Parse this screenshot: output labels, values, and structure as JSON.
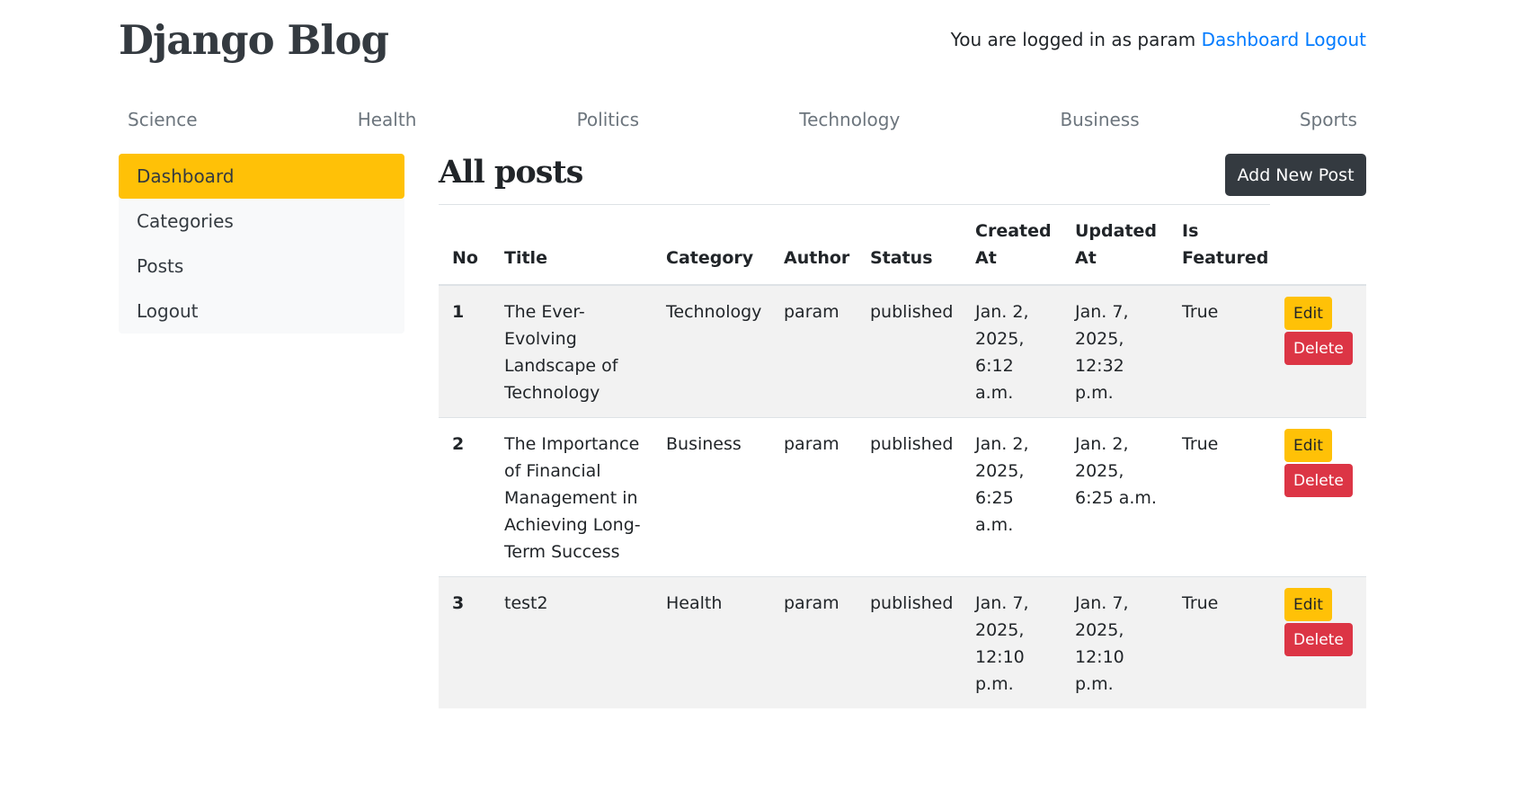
{
  "header": {
    "brand": "Django Blog",
    "logged_in_prefix": "You are logged in as param",
    "dashboard_link": "Dashboard",
    "logout_link": "Logout"
  },
  "categories_nav": [
    "Science",
    "Health",
    "Politics",
    "Technology",
    "Business",
    "Sports"
  ],
  "sidebar": {
    "items": [
      {
        "label": "Dashboard",
        "active": true
      },
      {
        "label": "Categories",
        "active": false
      },
      {
        "label": "Posts",
        "active": false
      },
      {
        "label": "Logout",
        "active": false
      }
    ]
  },
  "main": {
    "title": "All posts",
    "add_button": "Add New Post",
    "columns": [
      "No",
      "Title",
      "Category",
      "Author",
      "Status",
      "Created At",
      "Updated At",
      "Is Featured",
      ""
    ],
    "rows": [
      {
        "no": "1",
        "title": "The Ever-Evolving Landscape of Technology",
        "category": "Technology",
        "author": "param",
        "status": "published",
        "created": "Jan. 2, 2025, 6:12 a.m.",
        "updated": "Jan. 7, 2025, 12:32 p.m.",
        "featured": "True"
      },
      {
        "no": "2",
        "title": "The Importance of Financial Management in Achieving Long-Term Success",
        "category": "Business",
        "author": "param",
        "status": "published",
        "created": "Jan. 2, 2025, 6:25 a.m.",
        "updated": "Jan. 2, 2025, 6:25 a.m.",
        "featured": "True"
      },
      {
        "no": "3",
        "title": "test2",
        "category": "Health",
        "author": "param",
        "status": "published",
        "created": "Jan. 7, 2025, 12:10 p.m.",
        "updated": "Jan. 7, 2025, 12:10 p.m.",
        "featured": "True"
      }
    ],
    "edit_label": "Edit",
    "delete_label": "Delete"
  },
  "colors": {
    "accent_yellow": "#ffc107",
    "danger_red": "#dc3545",
    "dark": "#343a40",
    "link_blue": "#007bff"
  }
}
